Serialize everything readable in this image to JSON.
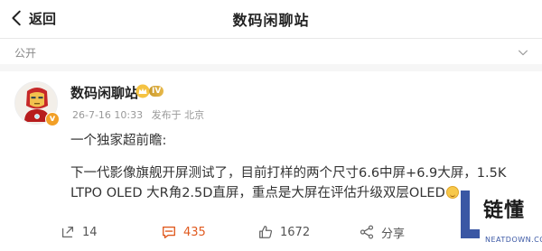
{
  "header": {
    "back_label": "返回",
    "title": "数码闲聊站"
  },
  "privacy": {
    "label": "公开"
  },
  "post": {
    "author": "数码闲聊站",
    "level_badge": "IV",
    "verified_badge": "v",
    "timestamp": "26-7-16 10:33",
    "source": "发布于 北京",
    "paragraph1": "一个独家超前瞻:",
    "paragraph2": "下一代影像旗舰开屏测试了，目前打样的两个尺寸6.6中屏+6.9大屏，1.5K LTPO OLED 大R角2.5D直屏，重点是大屏在评估升级双层OLED",
    "emoji": "smile-emoji"
  },
  "actions": {
    "repost_count": "14",
    "comment_count": "435",
    "like_count": "1672",
    "share_label": "分享",
    "colors": {
      "hot": "#e05a1f",
      "normal": "#555555"
    }
  },
  "watermark": {
    "brand": "链懂",
    "url": "NEATDOWN.COM",
    "colors": {
      "blue": "#3a57a4",
      "dark": "#1a1a1a"
    }
  }
}
